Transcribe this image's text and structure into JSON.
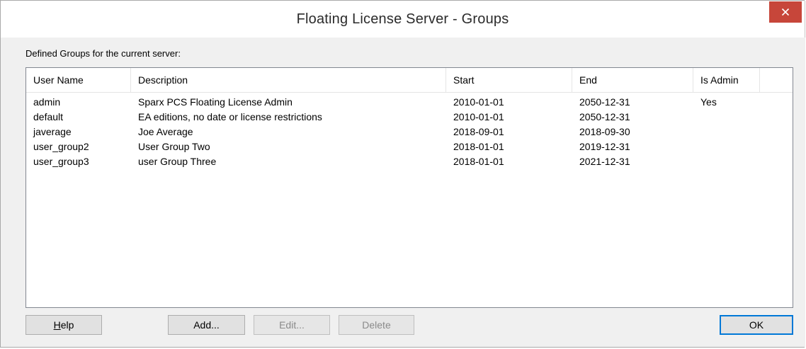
{
  "window": {
    "title": "Floating License Server - Groups",
    "close_label": "×"
  },
  "caption": "Defined Groups for the current server:",
  "table": {
    "columns": [
      "User Name",
      "Description",
      "Start",
      "End",
      "Is Admin"
    ],
    "rows": [
      [
        "admin",
        "Sparx PCS Floating License Admin",
        "2010-01-01",
        "2050-12-31",
        "Yes"
      ],
      [
        "default",
        "EA editions, no date or license restrictions",
        "2010-01-01",
        "2050-12-31",
        ""
      ],
      [
        "javerage",
        "Joe Average",
        "2018-09-01",
        "2018-09-30",
        ""
      ],
      [
        "user_group2",
        "User Group Two",
        "2018-01-01",
        "2019-12-31",
        ""
      ],
      [
        "user_group3",
        "user Group Three",
        "2018-01-01",
        "2021-12-31",
        ""
      ]
    ]
  },
  "buttons": {
    "help": "Help",
    "add": "Add...",
    "edit": "Edit...",
    "delete": "Delete",
    "ok": "OK"
  },
  "colors": {
    "close_button": "#c7463a",
    "default_button_border": "#0078d7"
  }
}
